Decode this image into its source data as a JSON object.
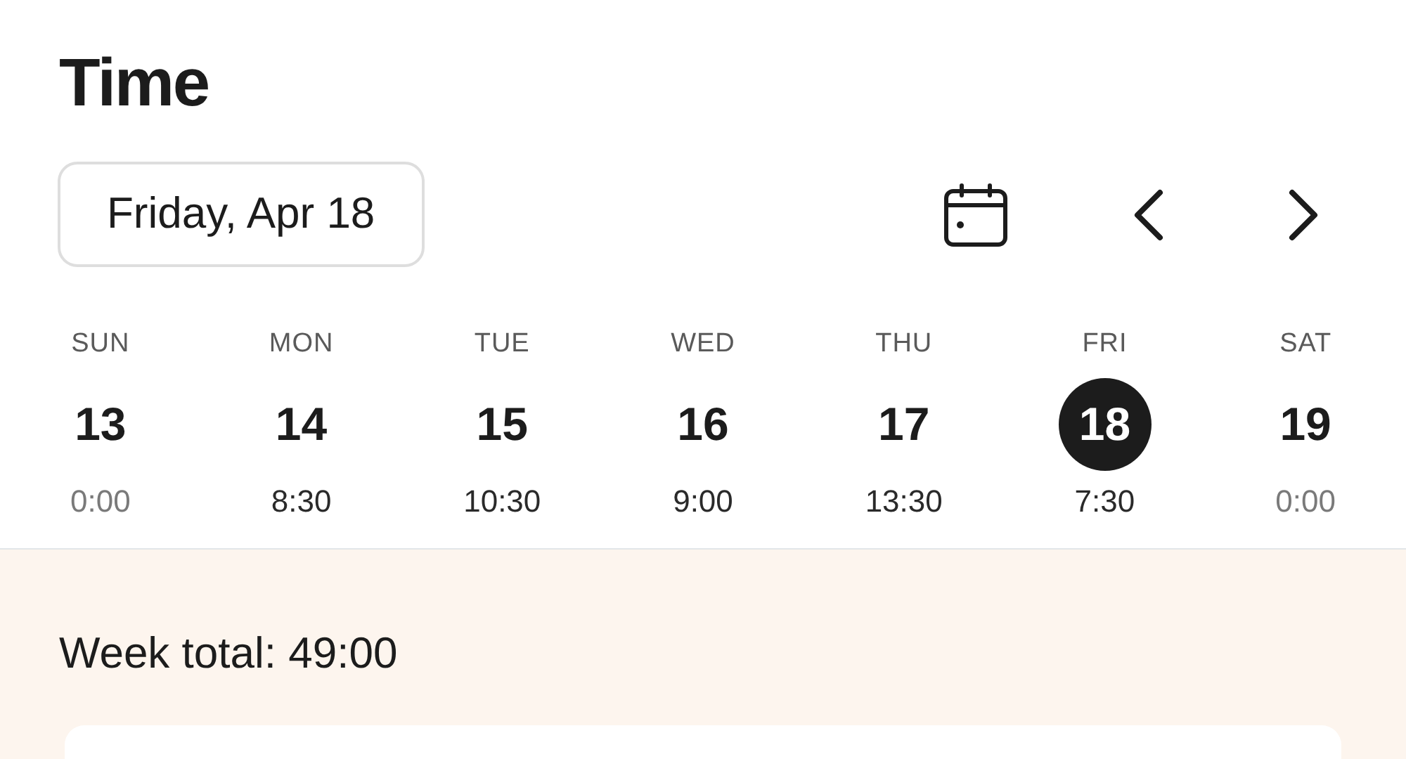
{
  "title": "Time",
  "date_button": "Friday, Apr 18",
  "days": [
    {
      "weekday": "SUN",
      "day": "13",
      "hours": "0:00",
      "selected": false,
      "muted": true
    },
    {
      "weekday": "MON",
      "day": "14",
      "hours": "8:30",
      "selected": false,
      "muted": false
    },
    {
      "weekday": "TUE",
      "day": "15",
      "hours": "10:30",
      "selected": false,
      "muted": false
    },
    {
      "weekday": "WED",
      "day": "16",
      "hours": "9:00",
      "selected": false,
      "muted": false
    },
    {
      "weekday": "THU",
      "day": "17",
      "hours": "13:30",
      "selected": false,
      "muted": false
    },
    {
      "weekday": "FRI",
      "day": "18",
      "hours": "7:30",
      "selected": true,
      "muted": false
    },
    {
      "weekday": "SAT",
      "day": "19",
      "hours": "0:00",
      "selected": false,
      "muted": true
    }
  ],
  "week_total": "Week total: 49:00"
}
